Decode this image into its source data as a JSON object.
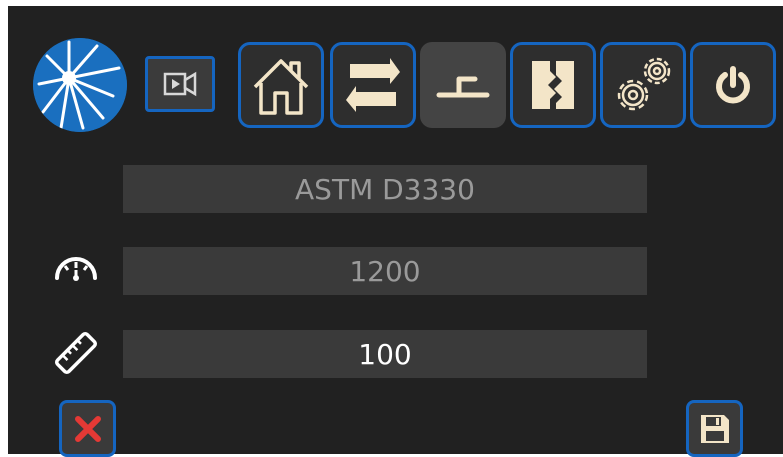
{
  "icons": {
    "logo": "starburst-logo",
    "camera": "video-camera-icon",
    "home": "home-icon",
    "transfer": "transfer-arrows-icon",
    "stepper": "step-icon",
    "sample": "sample-clamp-icon",
    "settings": "gears-icon",
    "power": "power-icon",
    "speed": "speedometer-icon",
    "length": "ruler-icon",
    "cancel": "close-icon",
    "save": "save-icon"
  },
  "colors": {
    "accent": "#1565c0",
    "icon_cream": "#f3e5c8",
    "cancel_red": "#e53935",
    "panel_bg": "#212121"
  },
  "form": {
    "standard": "ASTM D3330",
    "speed": "1200",
    "length": "100"
  }
}
